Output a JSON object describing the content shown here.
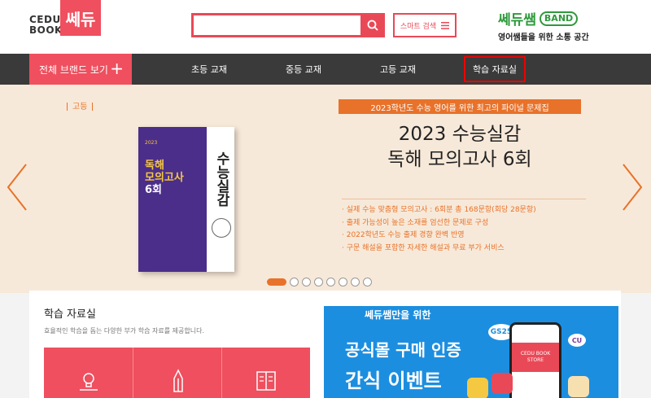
{
  "header": {
    "logo_cedu_line1": "CEDU",
    "logo_cedu_line2": "BOOK",
    "logo_sedu": "쎄듀",
    "search_placeholder": "",
    "smart_search_label": "스마트 검색",
    "band_title": "쎄듀쌤",
    "band_badge": "BAND",
    "band_sub": "영어쌤들을 위한 소통 공간"
  },
  "nav": {
    "all_brands": "전체 브랜드 보기",
    "items": [
      "초등 교재",
      "중등 교재",
      "고등 교재",
      "학습 자료실"
    ]
  },
  "hero": {
    "category": "고등",
    "tag": "2023학년도 수능 영어를 위한 최고의 파이널 문제집",
    "title_line1": "2023 수능실감",
    "title_line2": "독해 모의고사 6회",
    "bullets": [
      "실제 수능 맞춤형 모의고사 : 6회분 총 168문항(회당 28문항)",
      "출제 가능성이 높은 소재를 엄선한 문제로 구성",
      "2022학년도 수능 출제 경향 완벽 반영",
      "구문 해설을 포함한 자세한 해설과 무료 부가 서비스"
    ],
    "book": {
      "year": "2023",
      "front_title_line1": "독해",
      "front_title_line2": "모의고사",
      "front_title_line3": "6회",
      "spine_title": "수능실감"
    },
    "slide_count": 8,
    "active_slide": 0
  },
  "learning": {
    "title": "학습 자료실",
    "description": "효율적인 학습을 돕는 다양한 부가 학습 자료를 제공합니다."
  },
  "ad": {
    "top": "쎄듀쌤만을 위한",
    "line1": "공식몰 구매 인증",
    "line2": "간식 이벤트",
    "gs25": "GS25",
    "cu": "CU",
    "store": "CEDU BOOK STORE"
  },
  "colors": {
    "brand_red": "#ef4f5e",
    "nav_dark": "#3a3a3a",
    "hero_bg": "#f7e9d9",
    "accent_orange": "#e8722a",
    "band_green": "#2e9a3c",
    "ad_blue": "#1c8ee0"
  }
}
